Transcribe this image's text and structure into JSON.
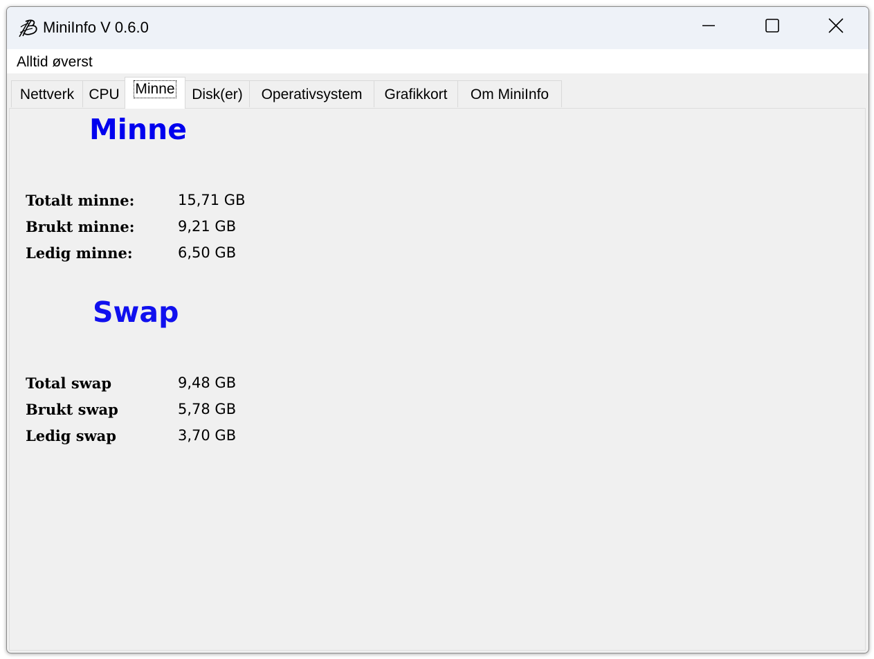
{
  "window": {
    "title": "MiniInfo V 0.6.0",
    "app_icon": "miniinfo-logo-icon",
    "controls": {
      "minimize_icon": "minimize-icon",
      "maximize_icon": "maximize-icon",
      "close_icon": "close-icon"
    }
  },
  "menubar": {
    "items": [
      {
        "label": "Alltid øverst"
      }
    ]
  },
  "tabs": [
    {
      "label": "Nettverk",
      "selected": false
    },
    {
      "label": "CPU",
      "selected": false
    },
    {
      "label": "Minne",
      "selected": true
    },
    {
      "label": "Disk(er)",
      "selected": false
    },
    {
      "label": "Operativsystem",
      "selected": false
    },
    {
      "label": "Grafikkort",
      "selected": false
    },
    {
      "label": "Om MiniInfo",
      "selected": false
    }
  ],
  "memory": {
    "heading": "Minne",
    "rows": [
      {
        "label": "Totalt minne:",
        "value": "15,71 GB"
      },
      {
        "label": "Brukt minne:",
        "value": "9,21 GB"
      },
      {
        "label": "Ledig minne:",
        "value": "6,50 GB"
      }
    ]
  },
  "swap": {
    "heading": "Swap",
    "rows": [
      {
        "label": "Total swap",
        "value": "9,48 GB"
      },
      {
        "label": "Brukt swap",
        "value": "5,78 GB"
      },
      {
        "label": "Ledig swap",
        "value": "3,70 GB"
      }
    ]
  },
  "colors": {
    "heading_minne": "#0000ee",
    "heading_swap": "#1010ee",
    "titlebar_bg": "#eef2f8",
    "content_bg": "#f0f0f0",
    "menubar_bg": "#ffffff"
  }
}
